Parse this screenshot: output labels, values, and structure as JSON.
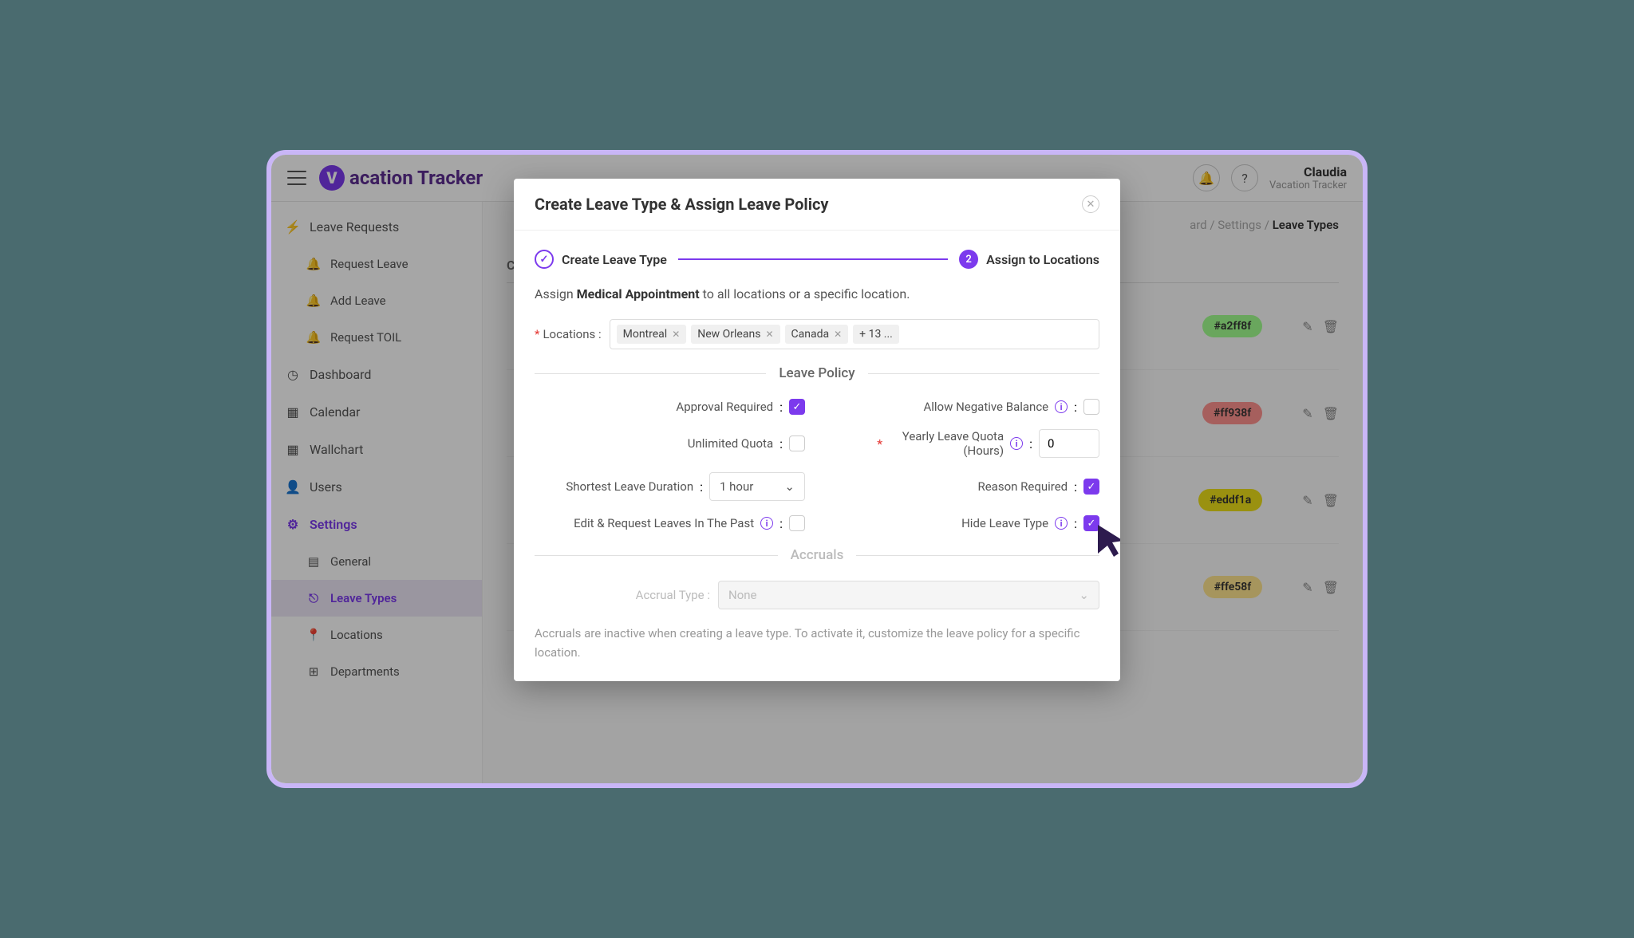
{
  "header": {
    "logo_text": "acation Tracker",
    "user_name": "Claudia",
    "user_sub": "Vacation Tracker"
  },
  "sidebar": {
    "leave_requests": "Leave Requests",
    "request_leave": "Request Leave",
    "add_leave": "Add Leave",
    "request_toil": "Request TOIL",
    "dashboard": "Dashboard",
    "calendar": "Calendar",
    "wallchart": "Wallchart",
    "users": "Users",
    "settings": "Settings",
    "general": "General",
    "leave_types": "Leave Types",
    "locations": "Locations",
    "departments": "Departments"
  },
  "breadcrumb": {
    "part1": "ard",
    "part2": "Settings",
    "current": "Leave Types"
  },
  "table": {
    "col_color": "Color",
    "rows": [
      {
        "hex": "#a2ff8f",
        "bg": "#a2ff8f"
      },
      {
        "hex": "#ff938f",
        "bg": "#ff938f"
      },
      {
        "hex": "#eddf1a",
        "bg": "#eddf1a"
      },
      {
        "hex": "#ffe58f",
        "bg": "#ffe58f"
      }
    ]
  },
  "modal": {
    "title": "Create Leave Type & Assign Leave Policy",
    "step1": "Create Leave Type",
    "step2": "Assign to Locations",
    "step2_num": "2",
    "assign_prefix": "Assign",
    "assign_name": "Medical Appointment",
    "assign_suffix": "to all locations or a specific location.",
    "locations_label": "Locations",
    "tags": [
      "Montreal",
      "New Orleans",
      "Canada"
    ],
    "tag_more": "+ 13 ...",
    "leave_policy_heading": "Leave Policy",
    "approval_required": "Approval Required",
    "allow_negative": "Allow Negative Balance",
    "unlimited_quota": "Unlimited Quota",
    "yearly_quota": "Yearly Leave Quota (Hours)",
    "quota_value": "0",
    "shortest_duration": "Shortest Leave Duration",
    "duration_value": "1 hour",
    "reason_required": "Reason Required",
    "edit_past": "Edit & Request Leaves In The Past",
    "hide_leave": "Hide Leave Type",
    "accruals_heading": "Accruals",
    "accrual_type": "Accrual Type",
    "accrual_value": "None",
    "accrual_note": "Accruals are inactive when creating a leave type. To activate it, customize the leave policy for a specific location."
  }
}
